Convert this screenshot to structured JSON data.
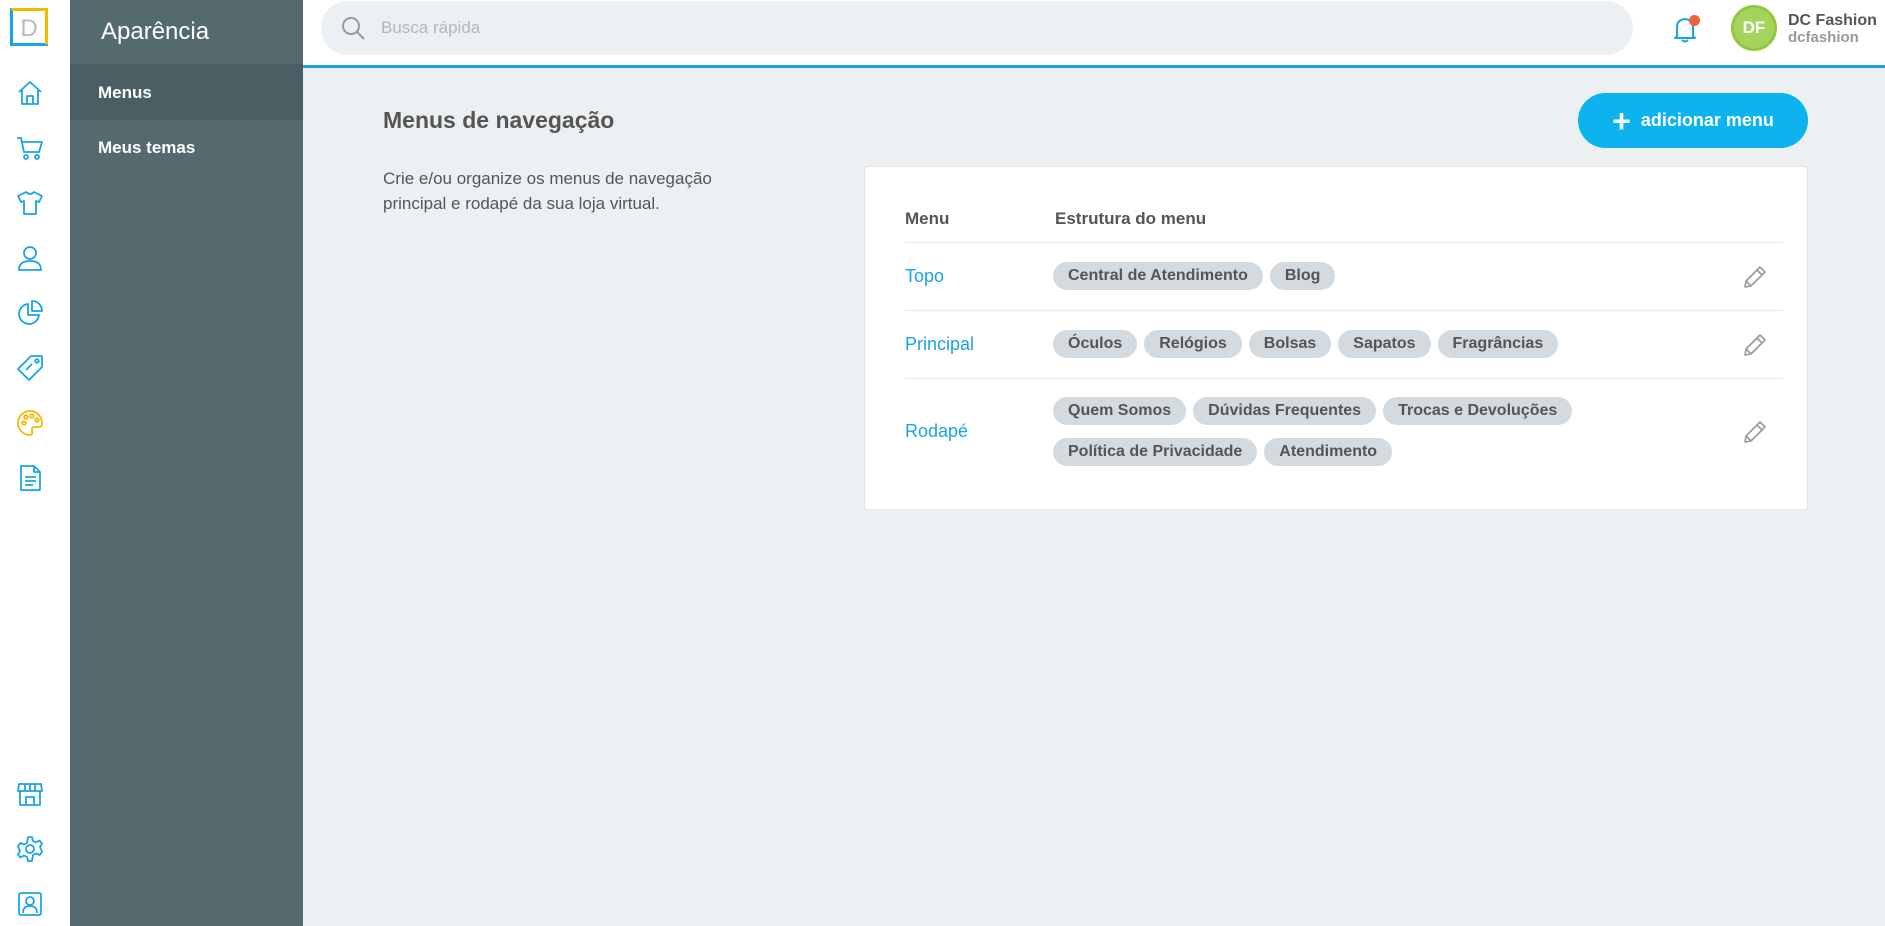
{
  "brand": {
    "logo_letter": "D"
  },
  "section": {
    "title": "Aparência",
    "items": [
      {
        "label": "Menus",
        "active": true
      },
      {
        "label": "Meus temas",
        "active": false
      }
    ]
  },
  "topbar": {
    "search_placeholder": "Busca rápida",
    "user": {
      "initials": "DF",
      "name": "DC Fashion",
      "handle": "dcfashion"
    }
  },
  "page": {
    "title": "Menus de navegação",
    "description": "Crie e/ou organize os menus de navegação principal e rodapé da sua loja virtual.",
    "add_button": "adicionar menu"
  },
  "table": {
    "headers": {
      "menu": "Menu",
      "structure": "Estrutura do menu"
    },
    "rows": [
      {
        "name": "Topo",
        "items": [
          "Central de Atendimento",
          "Blog"
        ]
      },
      {
        "name": "Principal",
        "items": [
          "Óculos",
          "Relógios",
          "Bolsas",
          "Sapatos",
          "Fragrâncias"
        ]
      },
      {
        "name": "Rodapé",
        "items": [
          "Quem Somos",
          "Dúvidas Frequentes",
          "Trocas e Devoluções",
          "Política de Privacidade",
          "Atendimento"
        ]
      }
    ]
  },
  "colors": {
    "accent": "#0cb3ee",
    "sidebar": "#546a6f",
    "active_icon": "#f5b800",
    "notification": "#f2623a"
  },
  "rail_icons": [
    "home-icon",
    "cart-icon",
    "shirt-icon",
    "customer-icon",
    "pie-chart-icon",
    "tag-icon",
    "palette-icon",
    "document-icon",
    "store-icon",
    "gear-icon",
    "account-icon"
  ]
}
